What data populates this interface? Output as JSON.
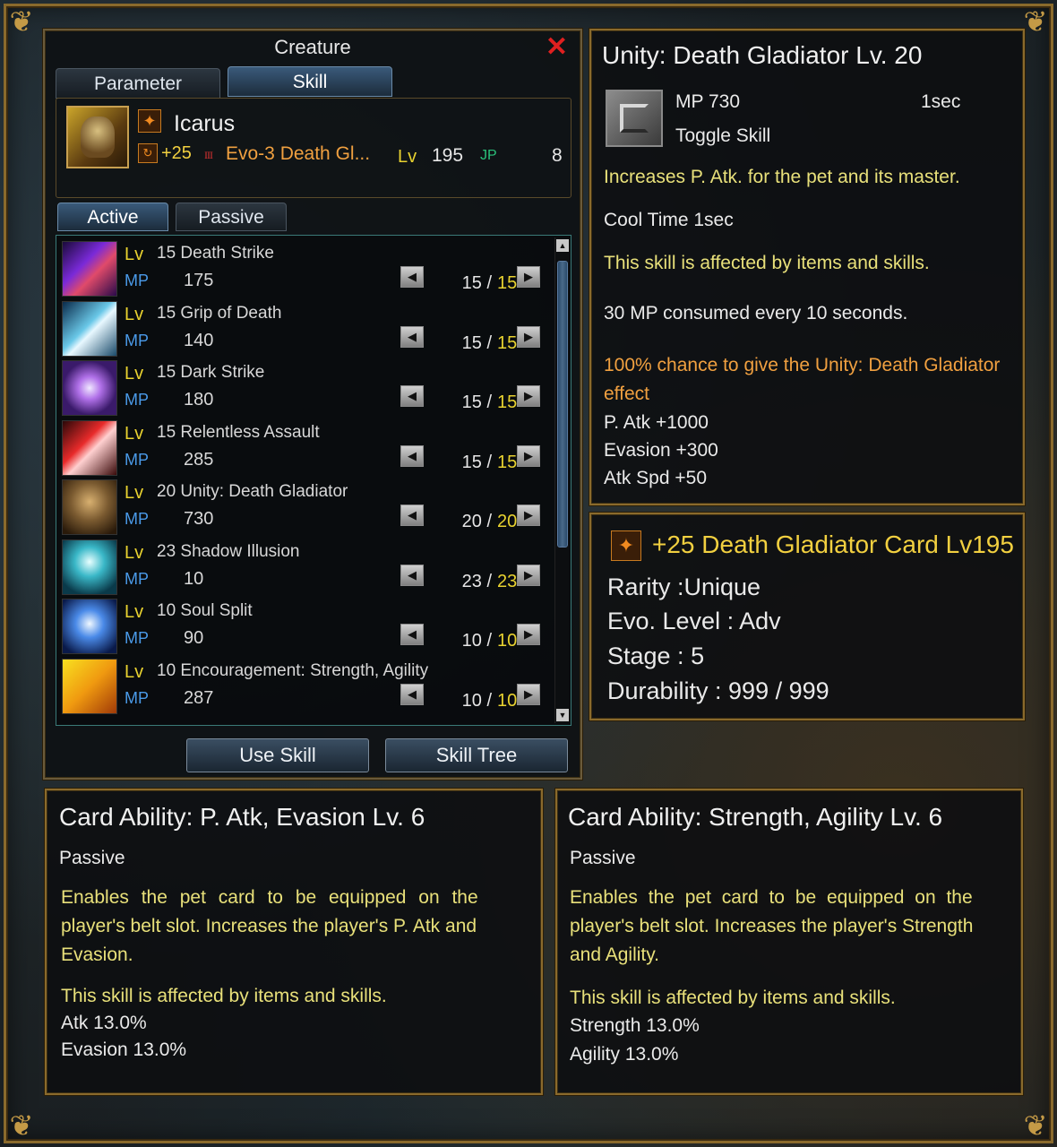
{
  "creature_window": {
    "title": "Creature",
    "close_icon": "close-icon",
    "tabs": [
      {
        "label": "Parameter",
        "active": false
      },
      {
        "label": "Skill",
        "active": true
      }
    ],
    "pet": {
      "name": "Icarus",
      "enhance": "+25",
      "tier_mark": "III",
      "card_name": "Evo-3 Death Gl...",
      "lv_label": "Lv",
      "level": "195",
      "jp_label": "JP",
      "jp_value": "8"
    },
    "subtabs": [
      {
        "label": "Active",
        "active": true
      },
      {
        "label": "Passive",
        "active": false
      }
    ],
    "lv_label": "Lv",
    "mp_label": "MP",
    "skills": [
      {
        "level": "15",
        "name": "Death Strike",
        "mp": "175",
        "cur": "15",
        "max": "15",
        "icon": "death-strike-icon"
      },
      {
        "level": "15",
        "name": "Grip of Death",
        "mp": "140",
        "cur": "15",
        "max": "15",
        "icon": "grip-of-death-icon"
      },
      {
        "level": "15",
        "name": "Dark Strike",
        "mp": "180",
        "cur": "15",
        "max": "15",
        "icon": "dark-strike-icon"
      },
      {
        "level": "15",
        "name": "Relentless Assault",
        "mp": "285",
        "cur": "15",
        "max": "15",
        "icon": "relentless-assault-icon"
      },
      {
        "level": "20",
        "name": "Unity: Death Gladiator",
        "mp": "730",
        "cur": "20",
        "max": "20",
        "icon": "unity-death-gladiator-icon"
      },
      {
        "level": "23",
        "name": "Shadow Illusion",
        "mp": "10",
        "cur": "23",
        "max": "23",
        "icon": "shadow-illusion-icon"
      },
      {
        "level": "10",
        "name": "Soul Split",
        "mp": "90",
        "cur": "10",
        "max": "10",
        "icon": "soul-split-icon"
      },
      {
        "level": "10",
        "name": "Encouragement: Strength, Agility",
        "mp": "287",
        "cur": "10",
        "max": "10",
        "icon": "encouragement-icon"
      }
    ],
    "buttons": {
      "use_skill": "Use Skill",
      "skill_tree": "Skill Tree"
    }
  },
  "skill_tooltip": {
    "title": "Unity: Death Gladiator Lv. 20",
    "mp": "MP 730",
    "cast_time": "1sec",
    "skill_type": "Toggle Skill",
    "description": "Increases P. Atk. for the pet and its master.",
    "cool_time": "Cool Time 1sec",
    "affected": "This skill is affected by items and skills.",
    "consumption": "30 MP consumed every 10 seconds.",
    "chance_line1": "100% chance to give the Unity: Death Gladiator",
    "chance_line2": "effect",
    "effects": [
      "P. Atk +1000",
      "Evasion +300",
      "Atk Spd +50"
    ]
  },
  "card_tooltip": {
    "title": "+25  Death Gladiator Card  Lv195",
    "rarity": "Rarity :Unique",
    "evo": "Evo. Level : Adv",
    "stage": "Stage : 5",
    "durability": "Durability : 999 / 999"
  },
  "ability_left": {
    "title": "Card Ability: P. Atk, Evasion Lv. 6",
    "type": "Passive",
    "desc_lines": [
      "Enables the pet card to be equipped on the",
      "player's belt slot. Increases the player's P. Atk and",
      "Evasion."
    ],
    "affected": "This skill is affected by items and skills.",
    "stats": [
      "Atk 13.0%",
      "Evasion 13.0%"
    ]
  },
  "ability_right": {
    "title": "Card Ability: Strength, Agility Lv. 6",
    "type": "Passive",
    "desc_lines": [
      "Enables the pet card to be equipped on the",
      "player's belt slot. Increases the player's Strength",
      "and Agility."
    ],
    "affected": "This skill is affected by items and skills.",
    "stats": [
      "Strength 13.0%",
      "Agility 13.0%"
    ]
  },
  "colors": {
    "frame_gold": "#8a6a2c",
    "text_yellow": "#e8e07a",
    "text_orange": "#f0a040",
    "mp_blue": "#4a9ae8",
    "lv_yellow": "#e8d230",
    "close_red": "#e02020"
  }
}
